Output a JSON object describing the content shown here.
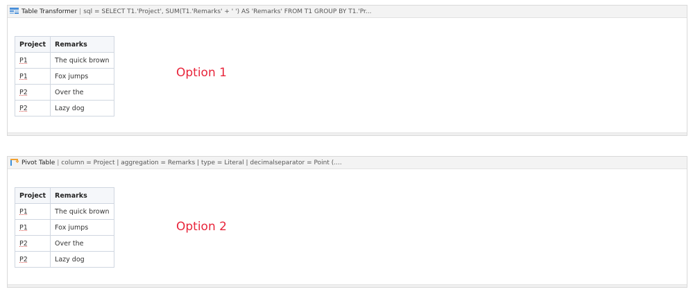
{
  "panels": [
    {
      "title": "Table Transformer",
      "params": "sql = SELECT T1.'Project', SUM(T1.'Remarks' + ' ') AS 'Remarks' FROM T1 GROUP BY T1.'Pr...",
      "icon": "table-transformer-icon",
      "columns": [
        "Project",
        "Remarks"
      ],
      "rows": [
        [
          "P1",
          "The quick brown"
        ],
        [
          "P1",
          "Fox jumps"
        ],
        [
          "P2",
          "Over the"
        ],
        [
          "P2",
          "Lazy dog"
        ]
      ],
      "annotation": "Option 1"
    },
    {
      "title": "Pivot Table",
      "params": "column = Project | aggregation = Remarks | type = Literal | decimalseparator = Point (....",
      "icon": "pivot-table-icon",
      "columns": [
        "Project",
        "Remarks"
      ],
      "rows": [
        [
          "P1",
          "The quick brown"
        ],
        [
          "P1",
          "Fox jumps"
        ],
        [
          "P2",
          "Over the"
        ],
        [
          "P2",
          "Lazy dog"
        ]
      ],
      "annotation": "Option 2"
    }
  ],
  "colors": {
    "annotation": "#e8253b",
    "header_bg": "#f3f3f3",
    "table_border": "#cfd6e0"
  }
}
